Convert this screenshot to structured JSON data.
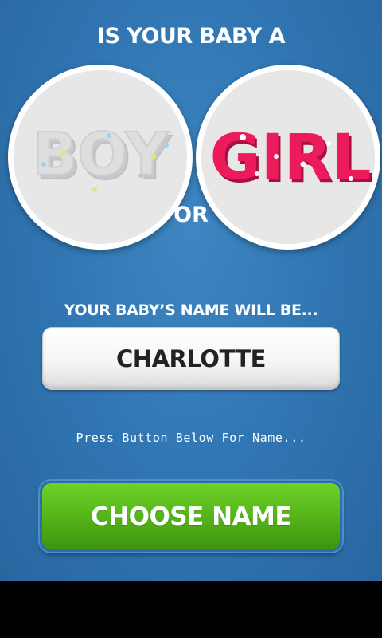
{
  "header": {
    "title": "IS YOUR BABY A"
  },
  "options": {
    "boy_label": "BOY",
    "girl_label": "GIRL",
    "or_label": "OR"
  },
  "name_section": {
    "label": "YOUR BABY’S NAME WILL BE...",
    "value": "CHARLOTTE"
  },
  "hint": "Press Button Below For Name...",
  "button": {
    "label": "CHOOSE NAME"
  },
  "colors": {
    "background": "#2f74b0",
    "girl_pink": "#ec1b5c",
    "boy_gray": "#dcdcdc",
    "button_green": "#55b51a",
    "white": "#ffffff"
  }
}
